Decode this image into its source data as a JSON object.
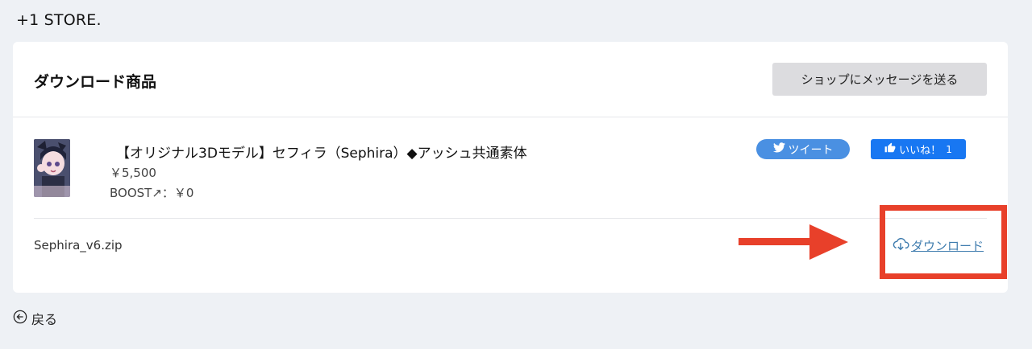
{
  "store": {
    "name": "+1 STORE."
  },
  "card": {
    "title": "ダウンロード商品",
    "message_button_label": "ショップにメッセージを送る"
  },
  "product": {
    "title": "【オリジナル3Dモデル】セフィラ（Sephira）◆アッシュ共通素体",
    "price": "￥5,500",
    "boost": "BOOST↗：￥0",
    "tweet_label": "ツイート",
    "like_label": "いいね！",
    "like_count": "1"
  },
  "file": {
    "name": "Sephira_v6.zip",
    "download_label": "ダウンロード"
  },
  "back": {
    "label": "戻る"
  },
  "colors": {
    "highlight": "#e8402a",
    "twitter": "#4a90e2",
    "facebook": "#1877f2",
    "link": "#3f7cae"
  }
}
